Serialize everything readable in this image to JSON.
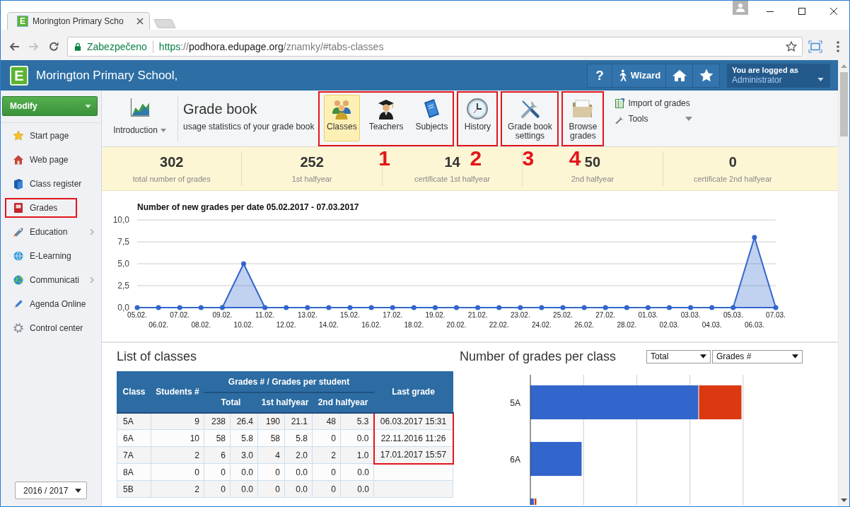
{
  "browser": {
    "tab": {
      "favicon": "E",
      "title": "Morington Primary Scho"
    },
    "address": {
      "security": "Zabezpečeno",
      "scheme": "https",
      "separator": "://",
      "host": "podhora.edupage.org",
      "path": "/znamky/#tabs-classes"
    }
  },
  "header": {
    "logo": "E",
    "title": "Morington Primary School,",
    "help": "?",
    "wizard": "Wizard",
    "account": {
      "caption": "You are logged as",
      "user": "Administrator"
    }
  },
  "sidebar": {
    "modify": "Modify",
    "items": [
      {
        "label": "Start page",
        "submenu": false,
        "marked": false
      },
      {
        "label": "Web page",
        "submenu": false,
        "marked": false
      },
      {
        "label": "Class register",
        "submenu": false,
        "marked": false
      },
      {
        "label": "Grades",
        "submenu": false,
        "marked": true
      },
      {
        "label": "Education",
        "submenu": true,
        "marked": false
      },
      {
        "label": "E-Learning",
        "submenu": false,
        "marked": false
      },
      {
        "label": "Communicati",
        "submenu": true,
        "marked": false
      },
      {
        "label": "Agenda Online",
        "submenu": false,
        "marked": false
      },
      {
        "label": "Control center",
        "submenu": false,
        "marked": false
      }
    ],
    "year": "2016 / 2017"
  },
  "toolbar": {
    "intro": "Introduction",
    "title": "Grade book",
    "subtitle": "usage statistics of your grade book",
    "groups": [
      {
        "marked": true,
        "callout": "1",
        "buttons": [
          {
            "label": "Classes",
            "selected": true
          },
          {
            "label": "Teachers",
            "selected": false
          },
          {
            "label": "Subjects",
            "selected": false
          }
        ]
      },
      {
        "marked": true,
        "callout": "2",
        "buttons": [
          {
            "label": "History",
            "selected": false
          }
        ]
      },
      {
        "marked": true,
        "callout": "3",
        "buttons": [
          {
            "label": "Grade book settings",
            "selected": false
          }
        ]
      },
      {
        "marked": true,
        "callout": "4",
        "buttons": [
          {
            "label": "Browse grades",
            "selected": false
          }
        ]
      }
    ],
    "links": [
      {
        "label": "Import of grades",
        "dropdown": false
      },
      {
        "label": "Tools",
        "dropdown": true
      }
    ]
  },
  "stats": [
    {
      "value": "302",
      "label": "total number of grades"
    },
    {
      "value": "252",
      "label": "1st halfyear"
    },
    {
      "value": "14",
      "label": "certificate 1st halfyear"
    },
    {
      "value": "50",
      "label": "2nd halfyear"
    },
    {
      "value": "0",
      "label": "certificate 2nd halfyear"
    }
  ],
  "grades_chart": {
    "chart_data": {
      "type": "area",
      "title": "Number of new grades per date 05.02.2017 - 07.03.2017",
      "categories": [
        "05.02.",
        "06.02.",
        "07.02.",
        "08.02.",
        "09.02.",
        "10.02.",
        "11.02.",
        "12.02.",
        "13.02.",
        "14.02.",
        "15.02.",
        "16.02.",
        "17.02.",
        "18.02.",
        "19.02.",
        "20.02.",
        "21.02.",
        "22.02.",
        "23.02.",
        "24.02.",
        "25.02.",
        "26.02.",
        "27.02.",
        "28.02.",
        "01.03.",
        "02.03.",
        "03.03.",
        "04.03.",
        "05.03.",
        "06.03.",
        "07.03."
      ],
      "values": [
        0,
        0,
        0,
        0,
        0,
        5,
        0,
        0,
        0,
        0,
        0,
        0,
        0,
        0,
        0,
        0,
        0,
        0,
        0,
        0,
        0,
        0,
        0,
        0,
        0,
        0,
        0,
        0,
        0,
        8,
        0
      ],
      "ylim": [
        0,
        10
      ],
      "yticks": [
        {
          "value": 0,
          "label": "0,0"
        },
        {
          "value": 2.5,
          "label": "2,5"
        },
        {
          "value": 5,
          "label": "5,0"
        },
        {
          "value": 7.5,
          "label": "7,5"
        },
        {
          "value": 10,
          "label": "10,0"
        }
      ],
      "grid": true
    }
  },
  "classes": {
    "title": "List of classes",
    "columns": {
      "class": "Class",
      "students": "Students #",
      "grades": "Grades # / Grades per student",
      "total": "Total",
      "first": "1st halfyear",
      "second": "2nd halfyear",
      "last_grade": "Last grade"
    },
    "rows": [
      {
        "class": "5A",
        "students": "9",
        "total": "238",
        "total_avg": "26.4",
        "first": "190",
        "first_avg": "21.1",
        "second": "48",
        "second_avg": "5.3",
        "last_grade": "06.03.2017 15:31",
        "marked": true
      },
      {
        "class": "6A",
        "students": "10",
        "total": "58",
        "total_avg": "5.8",
        "first": "58",
        "first_avg": "5.8",
        "second": "0",
        "second_avg": "0.0",
        "last_grade": "22.11.2016 11:26",
        "marked": true
      },
      {
        "class": "7A",
        "students": "2",
        "total": "6",
        "total_avg": "3.0",
        "first": "4",
        "first_avg": "2.0",
        "second": "2",
        "second_avg": "1.0",
        "last_grade": "17.01.2017 15:57",
        "marked": true
      },
      {
        "class": "8A",
        "students": "0",
        "total": "0",
        "total_avg": "0.0",
        "first": "0",
        "first_avg": "0.0",
        "second": "0",
        "second_avg": "0.0",
        "marked": false
      },
      {
        "class": "5B",
        "students": "2",
        "total": "0",
        "total_avg": "0.0",
        "first": "0",
        "first_avg": "0.0",
        "second": "0",
        "second_avg": "0.0",
        "marked": false
      }
    ]
  },
  "per_class": {
    "title": "Number of grades per class",
    "selects": [
      "Total",
      "Grades #"
    ],
    "labels": [
      "5A",
      "6A"
    ]
  }
}
